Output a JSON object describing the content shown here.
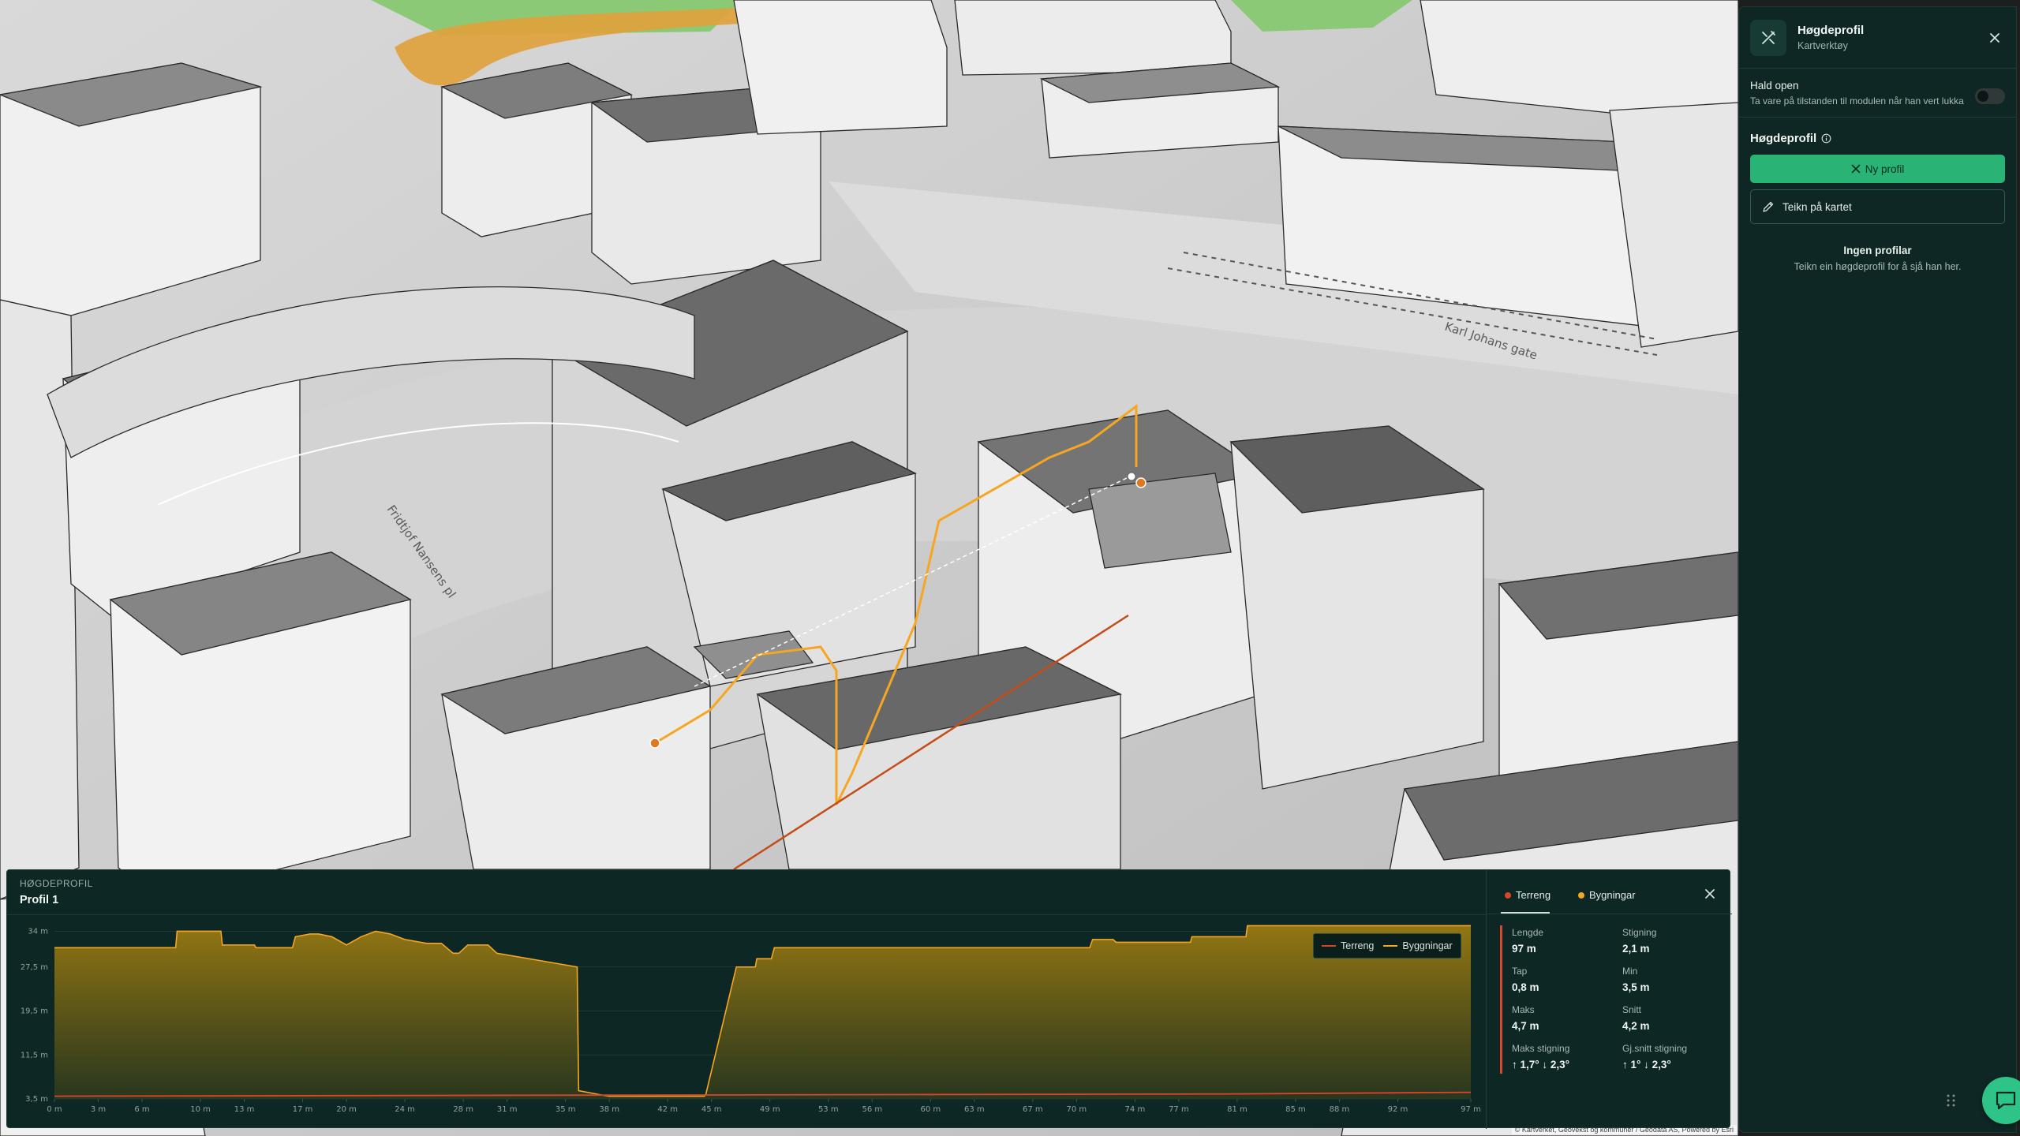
{
  "map": {
    "street_labels": [
      "Fridtjof Nansens pl",
      "Karl Johans gate"
    ],
    "attribution": "© Kartverket, Geovekst og kommuner / Geodata AS, Powered by Esri"
  },
  "side_panel": {
    "title": "Høgdeprofil",
    "subtitle": "Kartverktøy",
    "close_icon": "close-icon",
    "keep_open": {
      "title": "Hald open",
      "description": "Ta vare på tilstanden til modulen når han vert lukka",
      "enabled": false
    },
    "section_title": "Høgdeprofil",
    "new_profile_label": "Ny profil",
    "draw_label": "Teikn på kartet",
    "empty_title": "Ingen profilar",
    "empty_description": "Teikn ein høgdeprofil for å sjå han her."
  },
  "profile_panel": {
    "eyebrow": "HØGDEPROFIL",
    "title": "Profil 1",
    "legend": {
      "terrain": "Terreng",
      "buildings": "Byggningar"
    },
    "tabs": [
      {
        "label": "Terreng",
        "color": "#d7462a",
        "active": true
      },
      {
        "label": "Bygningar",
        "color": "#f5a623",
        "active": false
      }
    ],
    "stats": {
      "length_label": "Lengde",
      "length_value": "97 m",
      "climb_label": "Stigning",
      "climb_value": "2,1 m",
      "loss_label": "Tap",
      "loss_value": "0,8 m",
      "min_label": "Min",
      "min_value": "3,5 m",
      "max_label": "Maks",
      "max_value": "4,7 m",
      "avg_label": "Snitt",
      "avg_value": "4,2 m",
      "max_slope_label": "Maks stigning",
      "max_slope_value": "↑ 1,7° ↓ 2,3°",
      "avg_slope_label": "Gj.snitt stigning",
      "avg_slope_value": "↑ 1° ↓ 2,3°"
    }
  },
  "chart_data": {
    "type": "area",
    "title": "",
    "xlabel": "",
    "ylabel": "",
    "x_ticks": [
      "0 m",
      "3 m",
      "6 m",
      "10 m",
      "13 m",
      "17 m",
      "20 m",
      "24 m",
      "28 m",
      "31 m",
      "35 m",
      "38 m",
      "42 m",
      "45 m",
      "49 m",
      "53 m",
      "56 m",
      "60 m",
      "63 m",
      "67 m",
      "70 m",
      "74 m",
      "77 m",
      "81 m",
      "85 m",
      "88 m",
      "92 m",
      "97 m"
    ],
    "y_ticks": [
      "3,5 m",
      "11,5 m",
      "19,5 m",
      "27,5 m",
      "34 m"
    ],
    "xlim": [
      0,
      97
    ],
    "ylim": [
      3.5,
      35.5
    ],
    "grid": true,
    "legend_position": "top-right",
    "colors": {
      "terrain": "#d7462a",
      "buildings": "#f5a623"
    },
    "series": [
      {
        "name": "Terreng",
        "x": [
          0,
          20,
          40,
          60,
          80,
          97
        ],
        "y": [
          4.0,
          4.1,
          4.2,
          4.3,
          4.4,
          4.7
        ]
      },
      {
        "name": "Byggningar",
        "x": [
          0,
          8.3,
          8.4,
          11.4,
          11.5,
          13.7,
          13.8,
          16.3,
          16.5,
          17.5,
          18.1,
          19,
          20,
          21,
          22,
          23,
          24,
          25.5,
          26.5,
          27.3,
          27.7,
          28.3,
          29.7,
          30.3,
          35.8,
          35.9,
          37.5,
          38,
          41,
          44.5,
          44.6,
          46.7,
          46.8,
          48,
          48.1,
          49.1,
          49.3,
          70.9,
          71.1,
          72.5,
          72.7,
          77.8,
          77.9,
          81.6,
          81.7,
          97
        ],
        "y": [
          31.0,
          31.0,
          34.0,
          34.0,
          31.5,
          31.5,
          31.0,
          31.0,
          33.0,
          33.5,
          33.5,
          33.0,
          31.5,
          33.0,
          34.0,
          33.5,
          32.5,
          31.8,
          31.8,
          30.0,
          30.0,
          31.5,
          31.5,
          30.0,
          27.5,
          5.0,
          4.2,
          4.0,
          4.0,
          4.0,
          4.2,
          27.5,
          27.5,
          27.5,
          29.0,
          29.0,
          31.0,
          31.0,
          32.5,
          32.5,
          32.0,
          32.0,
          33.0,
          33.0,
          35.0,
          35.0
        ]
      }
    ]
  }
}
